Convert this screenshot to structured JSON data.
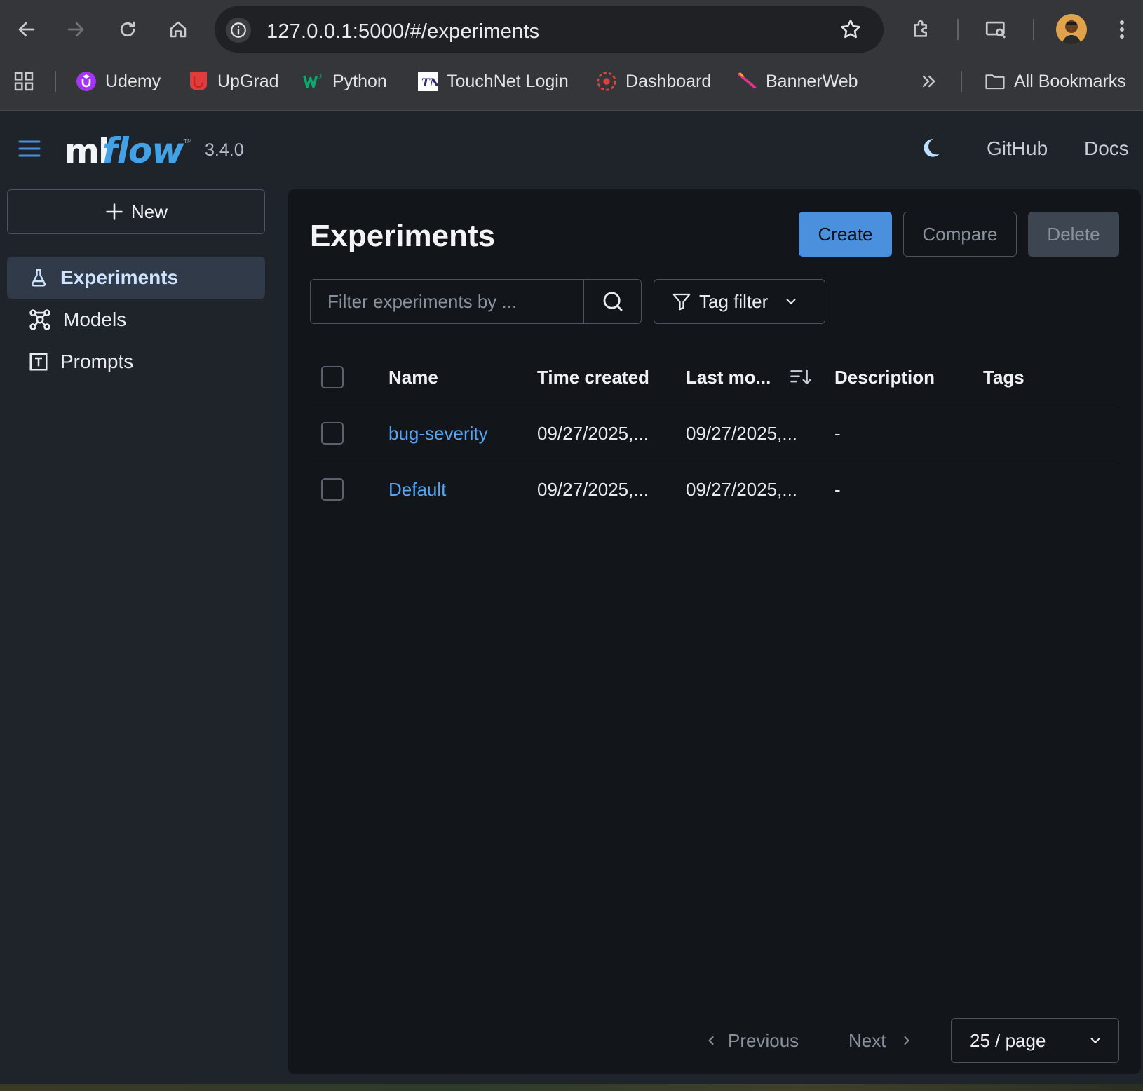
{
  "browser": {
    "url": "127.0.0.1:5000/#/experiments",
    "bookmarks": [
      {
        "label": "Udemy",
        "icon": "udemy-icon"
      },
      {
        "label": "UpGrad",
        "icon": "upgrad-icon"
      },
      {
        "label": "Python",
        "icon": "w3schools-icon"
      },
      {
        "label": "TouchNet Login",
        "icon": "touchnet-icon"
      },
      {
        "label": "Dashboard",
        "icon": "dashboard-icon"
      },
      {
        "label": "BannerWeb",
        "icon": "bannerweb-icon"
      }
    ],
    "all_bookmarks_label": "All Bookmarks"
  },
  "header": {
    "logo_text": "mlflow",
    "version": "3.4.0",
    "links": {
      "github": "GitHub",
      "docs": "Docs"
    }
  },
  "sidebar": {
    "new_label": "New",
    "items": [
      {
        "label": "Experiments",
        "icon": "flask-icon",
        "active": true
      },
      {
        "label": "Models",
        "icon": "models-icon",
        "active": false
      },
      {
        "label": "Prompts",
        "icon": "prompt-icon",
        "active": false
      }
    ]
  },
  "main": {
    "title": "Experiments",
    "buttons": {
      "create": "Create",
      "compare": "Compare",
      "delete": "Delete"
    },
    "filter_placeholder": "Filter experiments by ...",
    "tag_filter_label": "Tag filter",
    "table": {
      "columns": [
        "Name",
        "Time created",
        "Last mo...",
        "Description",
        "Tags"
      ],
      "rows": [
        {
          "name": "bug-severity",
          "time_created": "09/27/2025,...",
          "last_modified": "09/27/2025,...",
          "description": "-",
          "tags": ""
        },
        {
          "name": "Default",
          "time_created": "09/27/2025,...",
          "last_modified": "09/27/2025,...",
          "description": "-",
          "tags": ""
        }
      ]
    },
    "pagination": {
      "previous": "Previous",
      "next": "Next",
      "page_size": "25 / page"
    }
  },
  "colors": {
    "accent": "#4a90dd",
    "link": "#5aa4ef",
    "background": "#12161b",
    "sidebar_bg": "#1f232a"
  }
}
